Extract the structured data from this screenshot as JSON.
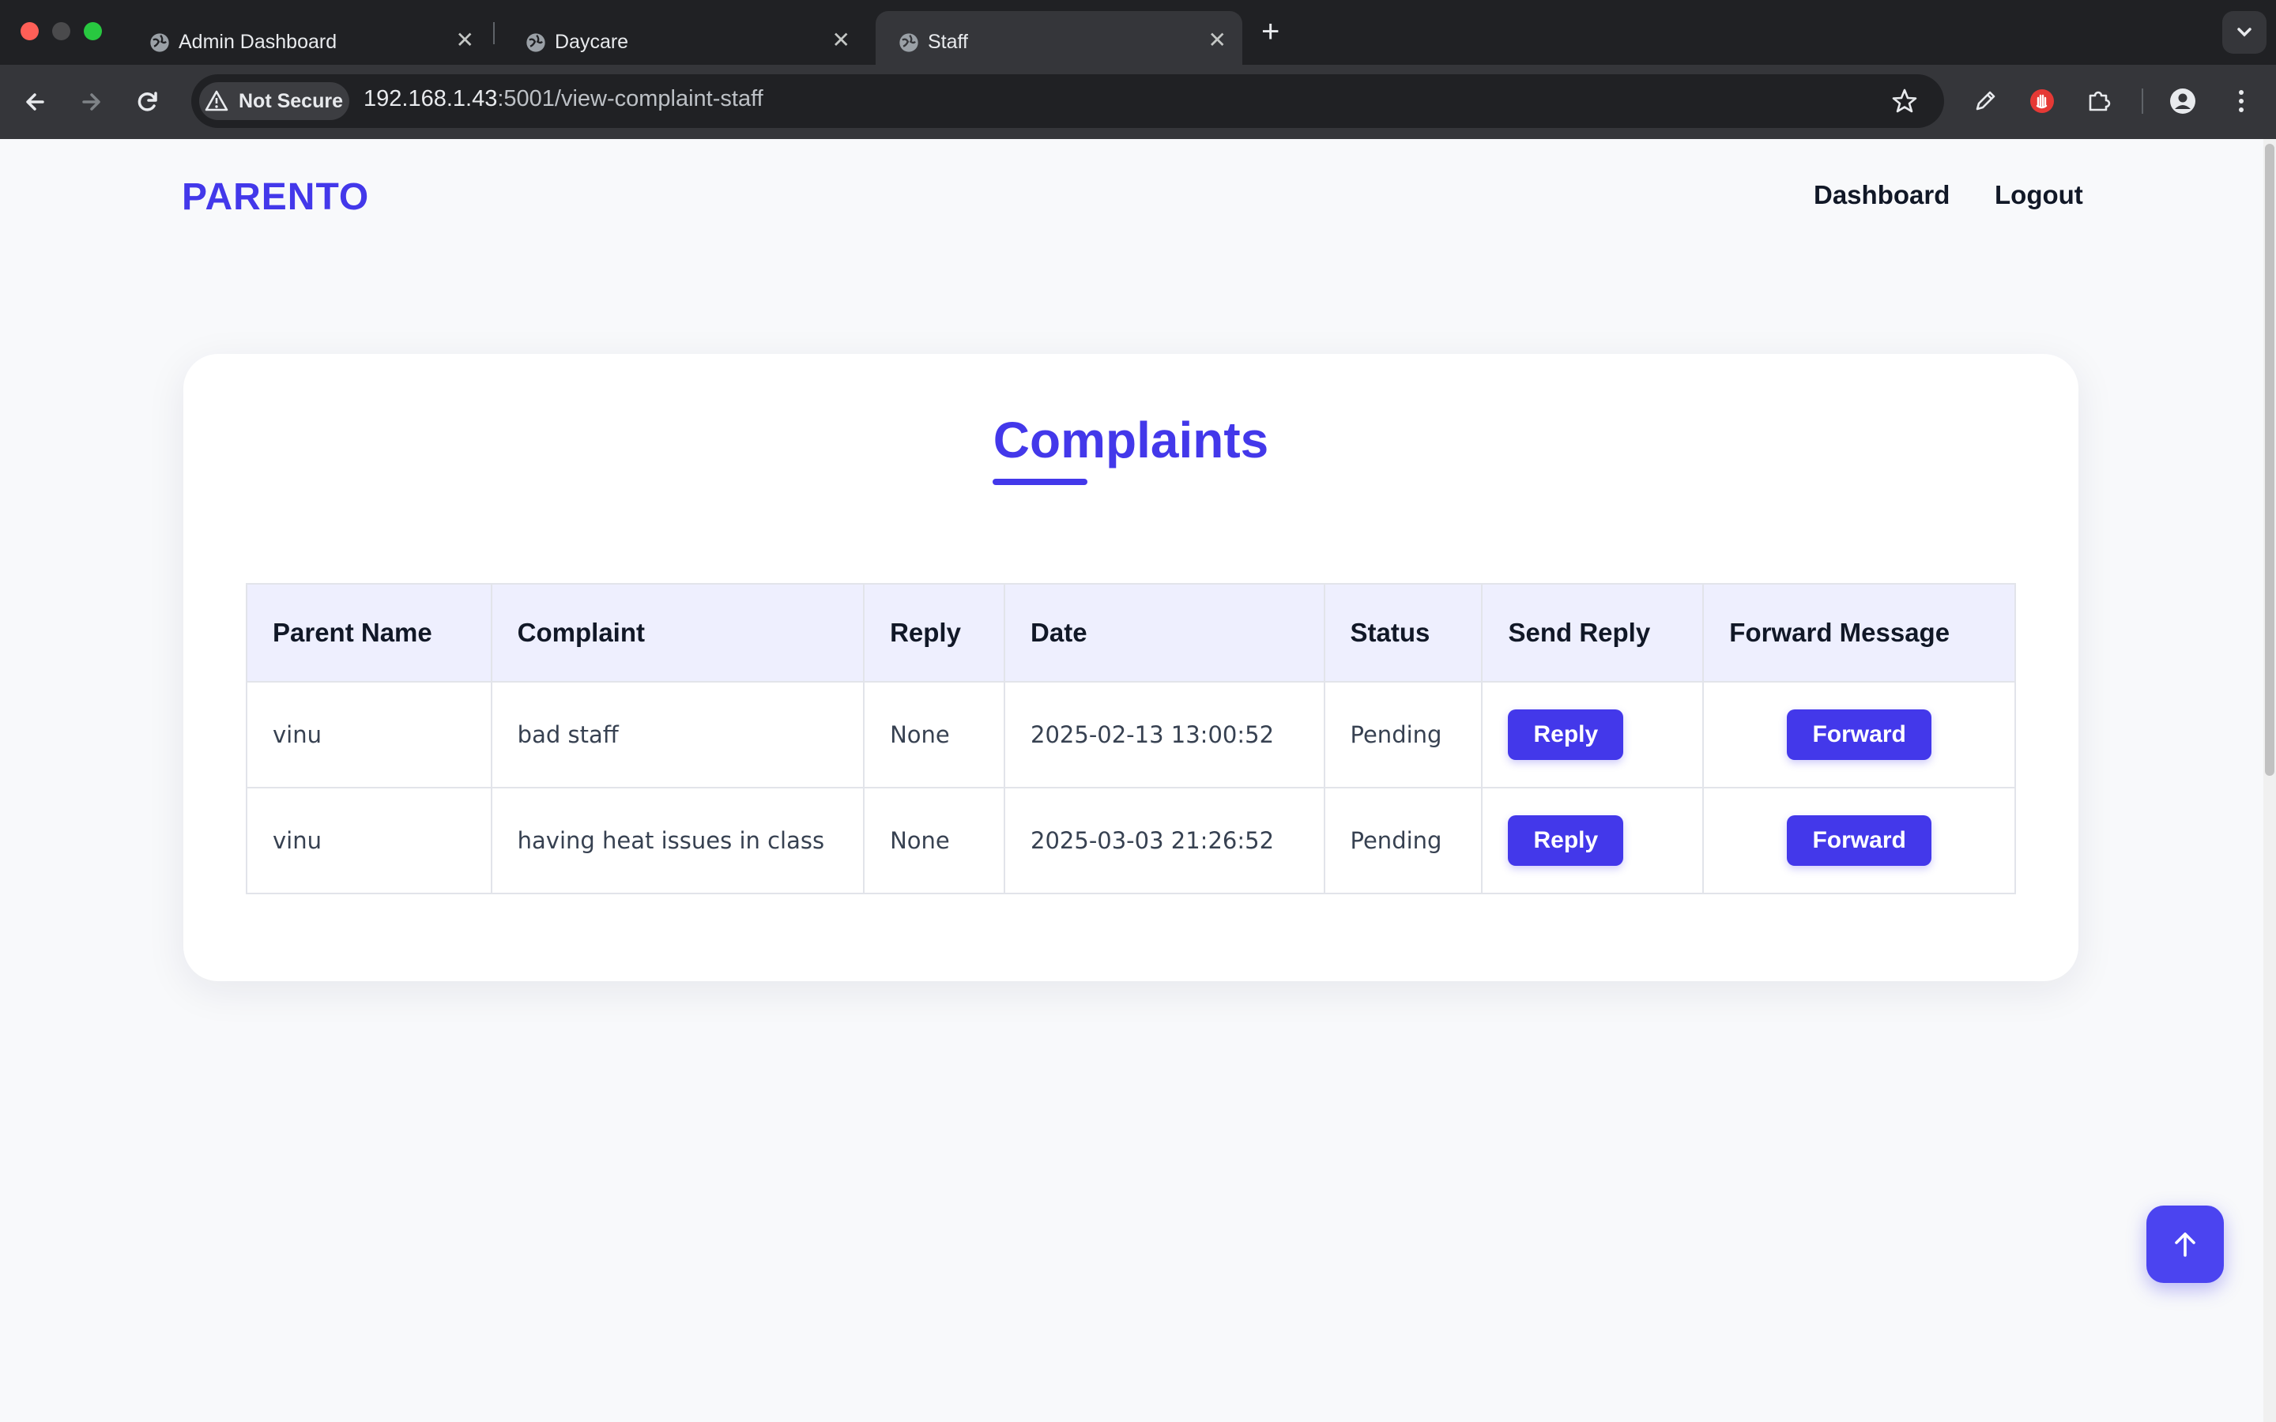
{
  "browser": {
    "tabs": [
      {
        "title": "Admin Dashboard",
        "active": false
      },
      {
        "title": "Daycare",
        "active": false
      },
      {
        "title": "Staff",
        "active": true
      }
    ],
    "security_label": "Not Secure",
    "url_host": "192.168.1.43",
    "url_rest": ":5001/view-complaint-staff"
  },
  "nav": {
    "brand": "PARENTO",
    "links": [
      "Dashboard",
      "Logout"
    ]
  },
  "main": {
    "title": "Complaints",
    "table": {
      "headers": [
        "Parent Name",
        "Complaint",
        "Reply",
        "Date",
        "Status",
        "Send Reply",
        "Forward Message"
      ],
      "rows": [
        {
          "parent": "vinu",
          "complaint": "bad staff",
          "reply": "None",
          "date": "2025-02-13 13:00:52",
          "status": "Pending",
          "reply_btn": "Reply",
          "forward_btn": "Forward"
        },
        {
          "parent": "vinu",
          "complaint": "having heat issues in class",
          "reply": "None",
          "date": "2025-03-03 21:26:52",
          "status": "Pending",
          "reply_btn": "Reply",
          "forward_btn": "Forward"
        }
      ]
    }
  },
  "colors": {
    "accent": "#4338ea",
    "header_bg": "#eeeffe"
  },
  "icons": [
    "globe-icon",
    "close-icon",
    "plus-icon",
    "back-icon",
    "forward-icon",
    "reload-icon",
    "warning-icon",
    "star-icon",
    "pen-icon",
    "stop-hand-icon",
    "puzzle-icon",
    "profile-icon",
    "kebab-menu-icon",
    "arrow-up-icon"
  ]
}
